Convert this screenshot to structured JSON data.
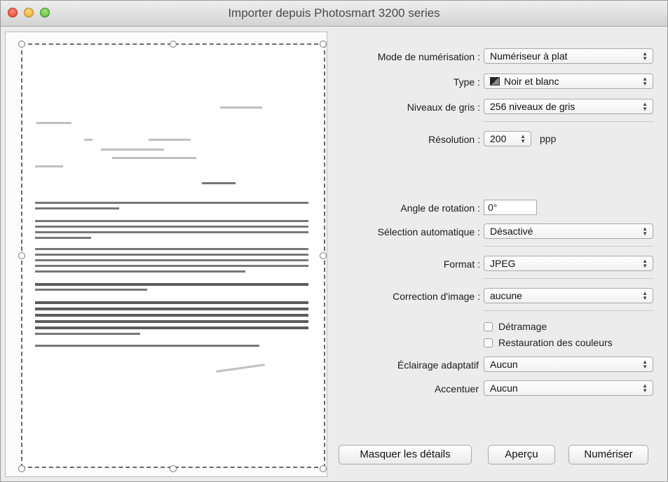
{
  "window": {
    "title": "Importer depuis Photosmart 3200 series"
  },
  "settings": {
    "mode": {
      "label": "Mode de numérisation :",
      "value": "Numériseur à plat"
    },
    "type": {
      "label": "Type :",
      "value": "Noir et blanc",
      "icon": "black-white-icon"
    },
    "gray": {
      "label": "Niveaux de gris :",
      "value": "256 niveaux de gris"
    },
    "resolution": {
      "label": "Résolution :",
      "value": "200",
      "unit": "ppp"
    },
    "rotation": {
      "label": "Angle de rotation :",
      "value": "0°"
    },
    "autoselect": {
      "label": "Sélection automatique :",
      "value": "Désactivé"
    },
    "format": {
      "label": "Format :",
      "value": "JPEG"
    },
    "correction": {
      "label": "Correction d'image :",
      "value": "aucune"
    },
    "detramage": {
      "label": "Détramage",
      "checked": false
    },
    "restauration": {
      "label": "Restauration des couleurs",
      "checked": false
    },
    "eclairage": {
      "label": "Éclairage adaptatif",
      "value": "Aucun"
    },
    "accentuer": {
      "label": "Accentuer",
      "value": "Aucun"
    }
  },
  "buttons": {
    "hide_details": "Masquer les détails",
    "preview": "Aperçu",
    "scan": "Numériser"
  },
  "colors": {
    "window_bg": "#ececec",
    "close": "#d9402e",
    "minimize": "#e2a52a",
    "maximize": "#53b531"
  }
}
